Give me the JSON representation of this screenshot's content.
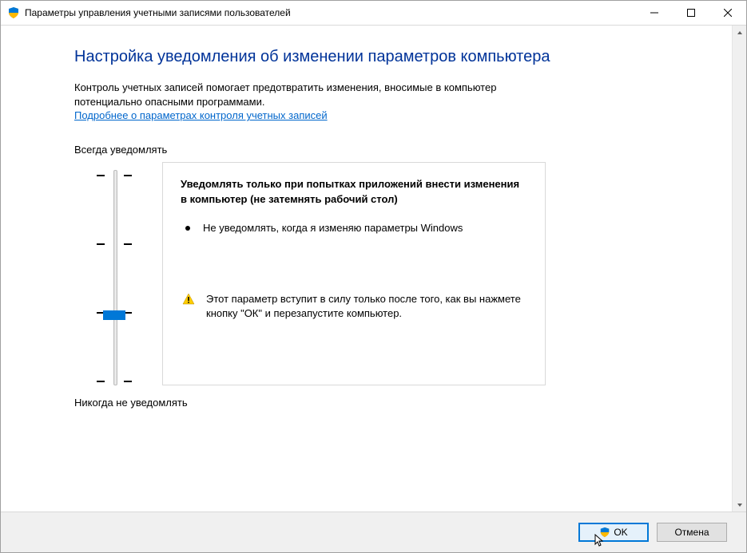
{
  "window": {
    "title": "Параметры управления учетными записями пользователей"
  },
  "heading": "Настройка уведомления об изменении параметров компьютера",
  "intro_line1": "Контроль учетных записей помогает предотвратить изменения, вносимые в компьютер",
  "intro_line2": "потенциально опасными программами.",
  "learn_more": "Подробнее о параметрах контроля учетных записей",
  "slider": {
    "label_top": "Всегда уведомлять",
    "label_bottom": "Никогда не уведомлять",
    "levels": 4,
    "current_level": 1
  },
  "description": {
    "title": "Уведомлять только при попытках приложений внести изменения в компьютер (не затемнять рабочий стол)",
    "bullet": "Не уведомлять, когда я изменяю параметры Windows",
    "warning": "Этот параметр вступит в силу только после того, как вы нажмете кнопку \"ОК\" и перезапустите компьютер."
  },
  "buttons": {
    "ok": "OK",
    "cancel": "Отмена"
  }
}
